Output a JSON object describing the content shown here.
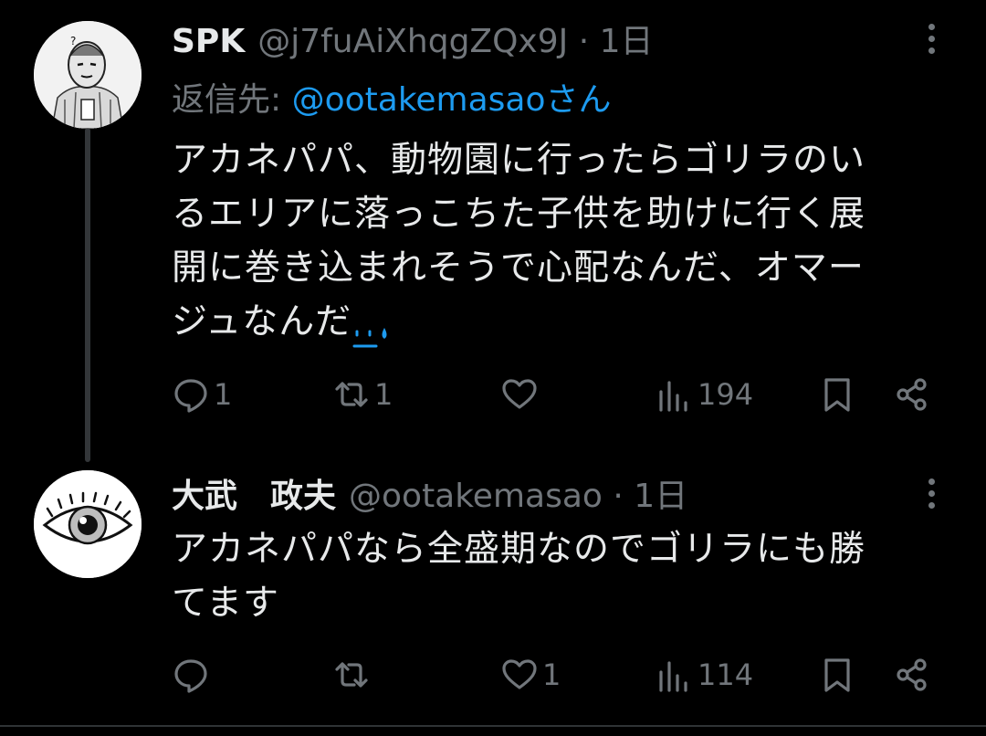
{
  "tweets": [
    {
      "display_name": "SPK",
      "handle": "@j7fuAiXhqgZQx9J",
      "separator": "·",
      "time": "1日",
      "reply_label": "返信先:",
      "reply_mention": "@ootakemasaoさん",
      "text_lines": [
        "アカネパパ、動物園に行ったらゴリラのい",
        "るエリアに落っこちた子供を助けに行く展",
        "開に巻き込まれそうで心配なんだ、オマー",
        "ジュなんだ"
      ],
      "emoji": "sweat-smile-emoji",
      "actions": {
        "replies": "1",
        "reposts": "1",
        "likes": "",
        "views": "194"
      }
    },
    {
      "display_name": "大武　政夫",
      "handle": "@ootakemasao",
      "separator": "·",
      "time": "1日",
      "text_lines": [
        "アカネパパなら全盛期なのでゴリラにも勝",
        "てます"
      ],
      "actions": {
        "replies": "",
        "reposts": "",
        "likes": "1",
        "views": "114"
      }
    }
  ],
  "colors": {
    "background": "#000000",
    "text": "#e7e9ea",
    "muted": "#71767b",
    "link": "#1d9bf0"
  }
}
